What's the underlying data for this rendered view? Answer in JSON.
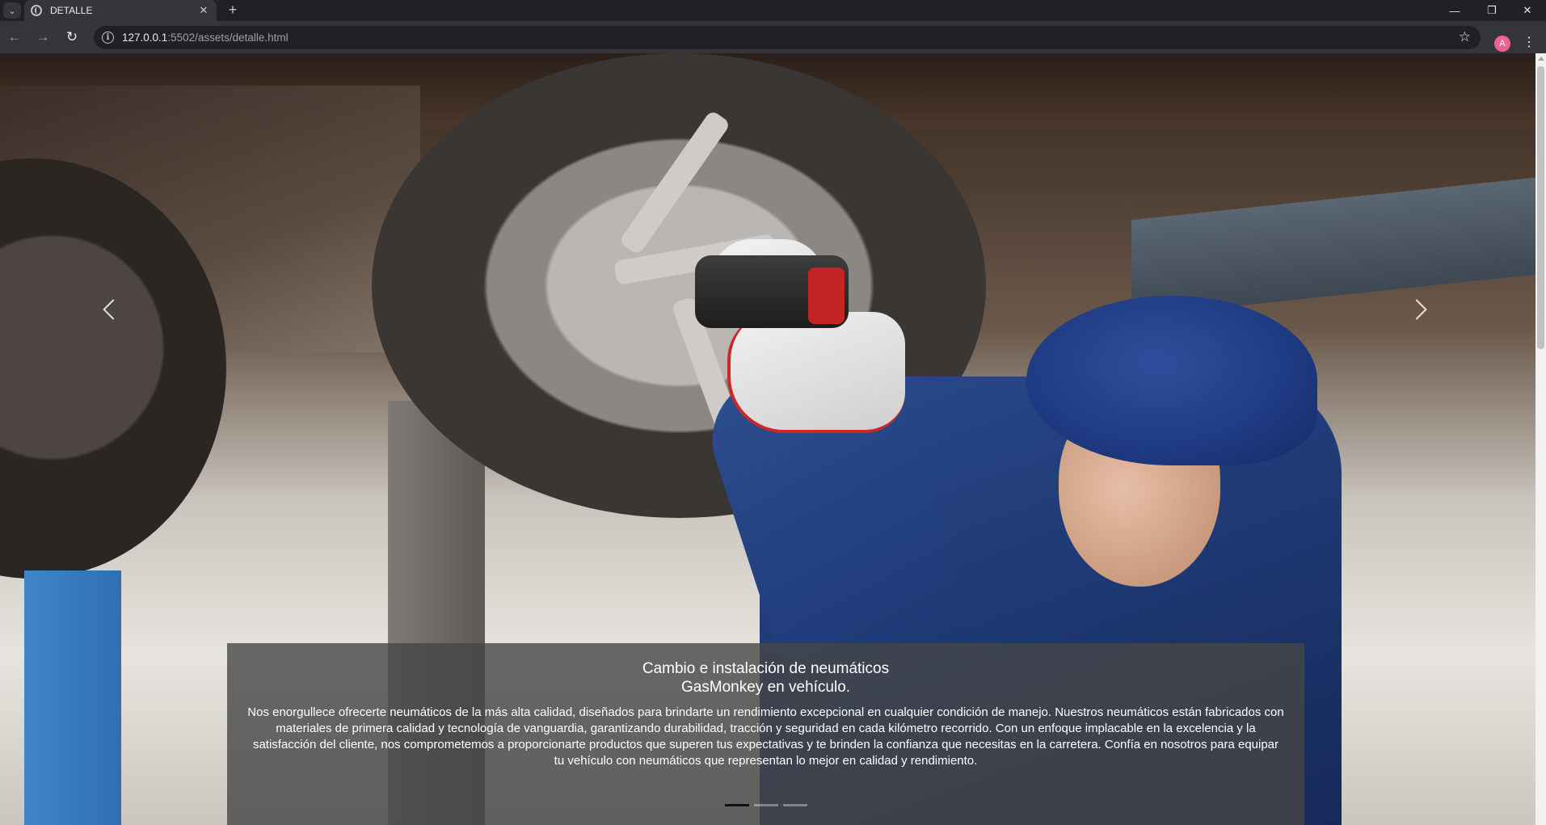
{
  "browser": {
    "tab_title": "DETALLE",
    "url_host": "127.0.0.1",
    "url_rest": ":5502/assets/detalle.html",
    "profile_initial": "A"
  },
  "hero": {
    "caption_title_line1": "Cambio e instalación de neumáticos",
    "caption_title_line2": "GasMonkey en vehículo.",
    "caption_text": "Nos enorgullece ofrecerte neumáticos de la más alta calidad, diseñados para brindarte un rendimiento excepcional en cualquier condición de manejo. Nuestros neumáticos están fabricados con materiales de primera calidad y tecnología de vanguardia, garantizando durabilidad, tracción y seguridad en cada kilómetro recorrido. Con un enfoque implacable en la excelencia y la satisfacción del cliente, nos comprometemos a proporcionarte productos que superen tus expectativas y te brinden la confianza que necesitas en la carretera. Confía en nosotros para equipar tu vehículo con neumáticos que representan lo mejor en calidad y rendimiento.",
    "slides_total": 3,
    "active_slide": 1
  },
  "icons": [
    "tab-search-icon",
    "site-favicon-icon",
    "close-icon",
    "plus-icon",
    "minimize-icon",
    "restore-icon",
    "window-close-icon",
    "back-arrow-icon",
    "forward-arrow-icon",
    "reload-icon",
    "site-info-icon",
    "bookmark-star-icon",
    "kebab-menu-icon",
    "chevron-left-icon",
    "chevron-right-icon"
  ]
}
